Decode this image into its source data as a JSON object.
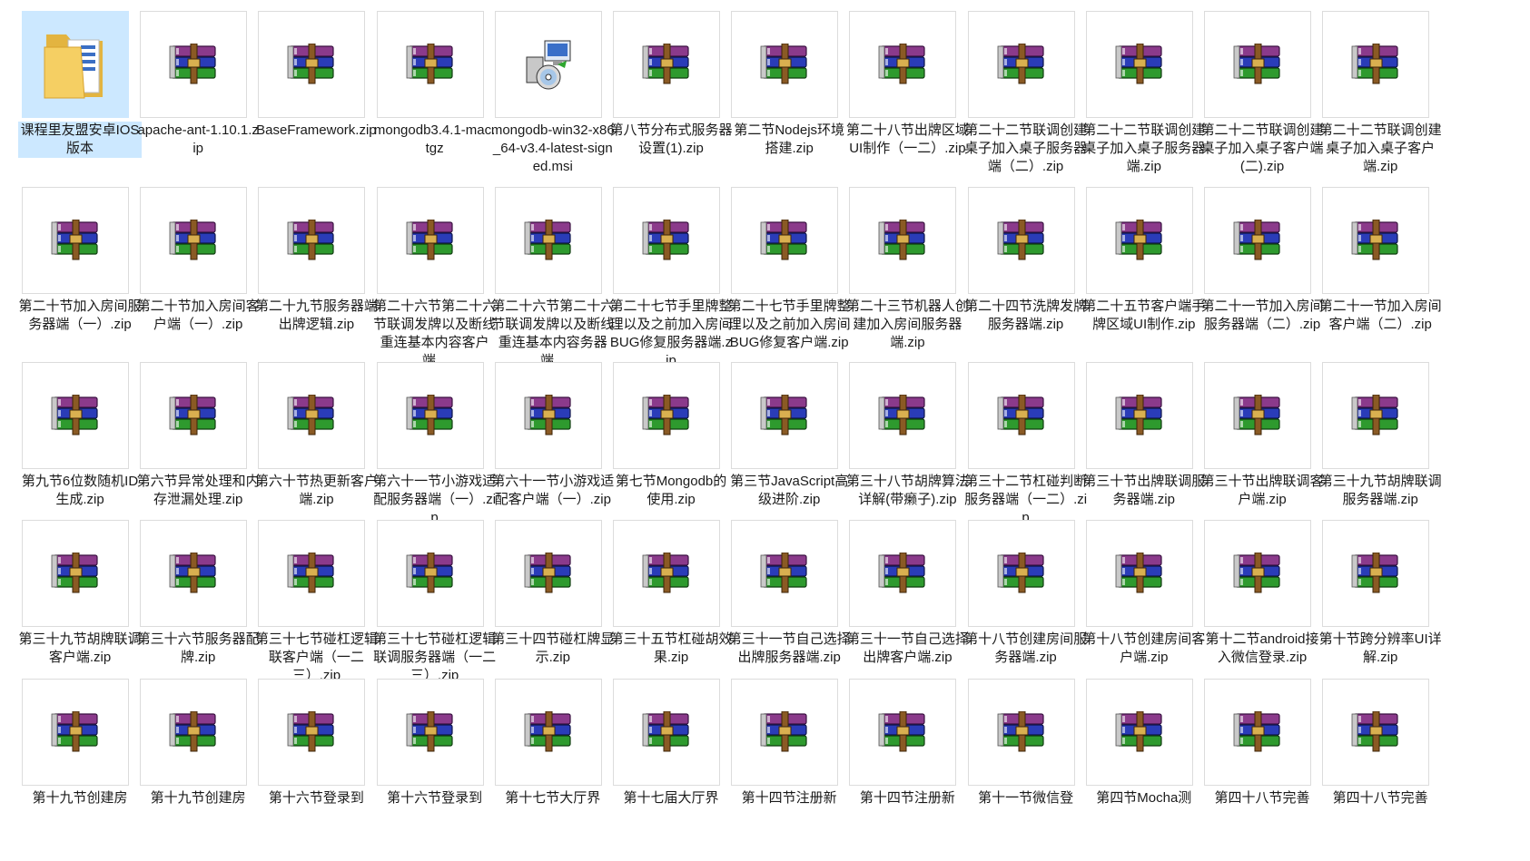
{
  "window": {
    "view": "large-icons"
  },
  "files": [
    {
      "label": "课程里友盟安卓IOS版本",
      "icon": "folder-icon",
      "selected": true
    },
    {
      "label": "apache-ant-1.10.1.zip",
      "icon": "winrar-archive-icon"
    },
    {
      "label": "BaseFramework.zip",
      "icon": "winrar-archive-icon"
    },
    {
      "label": "mongodb3.4.1-mac.tgz",
      "icon": "winrar-archive-icon"
    },
    {
      "label": "mongodb-win32-x86_64-v3.4-latest-signed.msi",
      "icon": "msi-installer-icon"
    },
    {
      "label": "第八节分布式服务器设置(1).zip",
      "icon": "winrar-archive-icon"
    },
    {
      "label": "第二节Nodejs环境搭建.zip",
      "icon": "winrar-archive-icon"
    },
    {
      "label": "第二十八节出牌区域UI制作（一二）.zip",
      "icon": "winrar-archive-icon"
    },
    {
      "label": "第二十二节联调创建桌子加入桌子服务器端（二）.zip",
      "icon": "winrar-archive-icon"
    },
    {
      "label": "第二十二节联调创建桌子加入桌子服务器端.zip",
      "icon": "winrar-archive-icon"
    },
    {
      "label": "第二十二节联调创建桌子加入桌子客户端(二).zip",
      "icon": "winrar-archive-icon"
    },
    {
      "label": "第二十二节联调创建桌子加入桌子客户端.zip",
      "icon": "winrar-archive-icon"
    },
    {
      "label": "第二十节加入房间服务器端（一）.zip",
      "icon": "winrar-archive-icon"
    },
    {
      "label": "第二十节加入房间客户端（一）.zip",
      "icon": "winrar-archive-icon"
    },
    {
      "label": "第二十九节服务器端出牌逻辑.zip",
      "icon": "winrar-archive-icon"
    },
    {
      "label": "第二十六节第二十六节联调发牌以及断线重连基本内容客户端...",
      "icon": "winrar-archive-icon"
    },
    {
      "label": "第二十六节第二十六节联调发牌以及断线重连基本内容务器端...",
      "icon": "winrar-archive-icon"
    },
    {
      "label": "第二十七节手里牌整理以及之前加入房间BUG修复服务器端.zip",
      "icon": "winrar-archive-icon"
    },
    {
      "label": "第二十七节手里牌整理以及之前加入房间BUG修复客户端.zip",
      "icon": "winrar-archive-icon"
    },
    {
      "label": "第二十三节机器人创建加入房间服务器端.zip",
      "icon": "winrar-archive-icon"
    },
    {
      "label": "第二十四节洗牌发牌服务器端.zip",
      "icon": "winrar-archive-icon"
    },
    {
      "label": "第二十五节客户端手牌区域UI制作.zip",
      "icon": "winrar-archive-icon"
    },
    {
      "label": "第二十一节加入房间服务器端（二）.zip",
      "icon": "winrar-archive-icon"
    },
    {
      "label": "第二十一节加入房间客户端（二）.zip",
      "icon": "winrar-archive-icon"
    },
    {
      "label": "第九节6位数随机ID生成.zip",
      "icon": "winrar-archive-icon"
    },
    {
      "label": "第六节异常处理和内存泄漏处理.zip",
      "icon": "winrar-archive-icon"
    },
    {
      "label": "第六十节热更新客户端.zip",
      "icon": "winrar-archive-icon"
    },
    {
      "label": "第六十一节小游戏适配服务器端（一）.zip",
      "icon": "winrar-archive-icon"
    },
    {
      "label": "第六十一节小游戏适配客户端（一）.zip",
      "icon": "winrar-archive-icon"
    },
    {
      "label": "第七节Mongodb的使用.zip",
      "icon": "winrar-archive-icon"
    },
    {
      "label": "第三节JavaScript高级进阶.zip",
      "icon": "winrar-archive-icon"
    },
    {
      "label": "第三十八节胡牌算法详解(带癞子).zip",
      "icon": "winrar-archive-icon"
    },
    {
      "label": "第三十二节杠碰判断服务器端（一二）.zip",
      "icon": "winrar-archive-icon"
    },
    {
      "label": "第三十节出牌联调服务器端.zip",
      "icon": "winrar-archive-icon"
    },
    {
      "label": "第三十节出牌联调客户端.zip",
      "icon": "winrar-archive-icon"
    },
    {
      "label": "第三十九节胡牌联调服务器端.zip",
      "icon": "winrar-archive-icon"
    },
    {
      "label": "第三十九节胡牌联调客户端.zip",
      "icon": "winrar-archive-icon"
    },
    {
      "label": "第三十六节服务器配牌.zip",
      "icon": "winrar-archive-icon"
    },
    {
      "label": "第三十七节碰杠逻辑联客户端（一二三）.zip",
      "icon": "winrar-archive-icon"
    },
    {
      "label": "第三十七节碰杠逻辑联调服务器端（一二三）.zip",
      "icon": "winrar-archive-icon"
    },
    {
      "label": "第三十四节碰杠牌显示.zip",
      "icon": "winrar-archive-icon"
    },
    {
      "label": "第三十五节杠碰胡效果.zip",
      "icon": "winrar-archive-icon"
    },
    {
      "label": "第三十一节自己选择出牌服务器端.zip",
      "icon": "winrar-archive-icon"
    },
    {
      "label": "第三十一节自己选择出牌客户端.zip",
      "icon": "winrar-archive-icon"
    },
    {
      "label": "第十八节创建房间服务器端.zip",
      "icon": "winrar-archive-icon"
    },
    {
      "label": "第十八节创建房间客户端.zip",
      "icon": "winrar-archive-icon"
    },
    {
      "label": "第十二节android接入微信登录.zip",
      "icon": "winrar-archive-icon"
    },
    {
      "label": "第十节跨分辨率UI详解.zip",
      "icon": "winrar-archive-icon"
    },
    {
      "label": "第十九节创建房",
      "icon": "winrar-archive-icon"
    },
    {
      "label": "第十九节创建房",
      "icon": "winrar-archive-icon"
    },
    {
      "label": "第十六节登录到",
      "icon": "winrar-archive-icon"
    },
    {
      "label": "第十六节登录到",
      "icon": "winrar-archive-icon"
    },
    {
      "label": "第十七节大厅界",
      "icon": "winrar-archive-icon"
    },
    {
      "label": "第十七届大厅界",
      "icon": "winrar-archive-icon"
    },
    {
      "label": "第十四节注册新",
      "icon": "winrar-archive-icon"
    },
    {
      "label": "第十四节注册新",
      "icon": "winrar-archive-icon"
    },
    {
      "label": "第十一节微信登",
      "icon": "winrar-archive-icon"
    },
    {
      "label": "第四节Mocha测",
      "icon": "winrar-archive-icon"
    },
    {
      "label": "第四十八节完善",
      "icon": "winrar-archive-icon"
    },
    {
      "label": "第四十八节完善",
      "icon": "winrar-archive-icon"
    }
  ]
}
